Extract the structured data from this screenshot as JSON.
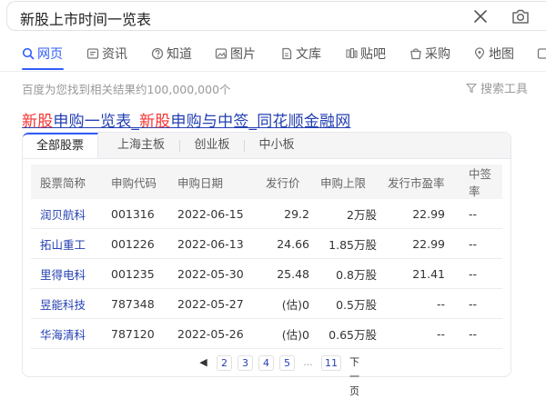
{
  "search": {
    "query": "新股上市时间一览表"
  },
  "nav": {
    "items": [
      {
        "label": "网页",
        "icon": "search-icon",
        "active": true
      },
      {
        "label": "资讯",
        "icon": "news-icon"
      },
      {
        "label": "知道",
        "icon": "question-icon"
      },
      {
        "label": "图片",
        "icon": "image-icon"
      },
      {
        "label": "文库",
        "icon": "document-icon"
      },
      {
        "label": "贴吧",
        "icon": "tieba-icon"
      },
      {
        "label": "采购",
        "icon": "purchase-icon"
      },
      {
        "label": "地图",
        "icon": "map-icon"
      }
    ]
  },
  "results": {
    "info": "百度为您找到相关结果约100,000,000个",
    "tools_label": "搜索工具"
  },
  "result": {
    "title_parts": [
      "新股",
      "申购一览表_",
      "新股",
      "申购与中签_同花顺金融网"
    ]
  },
  "card": {
    "tabs": [
      "全部股票",
      "上海主板",
      "创业板",
      "中小板"
    ],
    "headers": [
      "股票简称",
      "申购代码",
      "申购日期",
      "发行价",
      "申购上限",
      "发行市盈率",
      "中签率"
    ],
    "rows": [
      [
        "润贝航科",
        "001316",
        "2022-06-15",
        "29.2",
        "2万股",
        "22.99",
        "--"
      ],
      [
        "拓山重工",
        "001226",
        "2022-06-13",
        "24.66",
        "1.85万股",
        "22.99",
        "--"
      ],
      [
        "里得电科",
        "001235",
        "2022-05-30",
        "25.48",
        "0.8万股",
        "21.41",
        "--"
      ],
      [
        "昱能科技",
        "787348",
        "2022-05-27",
        "(估)0",
        "0.5万股",
        "--",
        "--"
      ],
      [
        "华海清科",
        "787120",
        "2022-05-26",
        "(估)0",
        "0.65万股",
        "--",
        "--"
      ]
    ],
    "pager": [
      "◀",
      "2",
      "3",
      "4",
      "5",
      "...",
      "11",
      "下一页"
    ]
  }
}
